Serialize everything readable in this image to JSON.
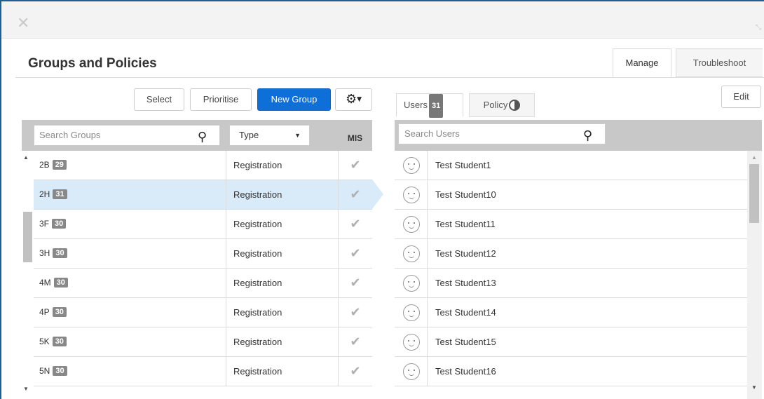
{
  "window": {
    "close_glyph": "✕",
    "resize_glyph": "⤡"
  },
  "page_title": "Groups and Policies",
  "tabs": [
    {
      "label": "Manage",
      "active": true
    },
    {
      "label": "Troubleshoot",
      "active": false
    }
  ],
  "toolbar": {
    "select_label": "Select",
    "prioritise_label": "Prioritise",
    "new_group_label": "New Group",
    "gear_icon": "gear-icon",
    "edit_label": "Edit"
  },
  "groups_panel": {
    "search_placeholder": "Search Groups",
    "type_filter_value": "Type",
    "mis_header": "MIS",
    "rows": [
      {
        "name": "2B",
        "count": "29",
        "type": "Registration",
        "mis": true,
        "selected": false
      },
      {
        "name": "2H",
        "count": "31",
        "type": "Registration",
        "mis": true,
        "selected": true
      },
      {
        "name": "3F",
        "count": "30",
        "type": "Registration",
        "mis": true,
        "selected": false
      },
      {
        "name": "3H",
        "count": "30",
        "type": "Registration",
        "mis": true,
        "selected": false
      },
      {
        "name": "4M",
        "count": "30",
        "type": "Registration",
        "mis": true,
        "selected": false
      },
      {
        "name": "4P",
        "count": "30",
        "type": "Registration",
        "mis": true,
        "selected": false
      },
      {
        "name": "5K",
        "count": "30",
        "type": "Registration",
        "mis": true,
        "selected": false
      },
      {
        "name": "5N",
        "count": "30",
        "type": "Registration",
        "mis": true,
        "selected": false
      }
    ]
  },
  "users_panel": {
    "tabs": {
      "users_label": "Users",
      "users_count": "31",
      "policy_label": "Policy"
    },
    "search_placeholder": "Search Users",
    "users": [
      "Test Student1",
      "Test Student10",
      "Test Student11",
      "Test Student12",
      "Test Student13",
      "Test Student14",
      "Test Student15",
      "Test Student16"
    ]
  },
  "colors": {
    "accent": "#0f6fd9",
    "selected_row": "#d9eaf8",
    "header_gray": "#c8c8c8",
    "window_border": "#1f5f99"
  }
}
